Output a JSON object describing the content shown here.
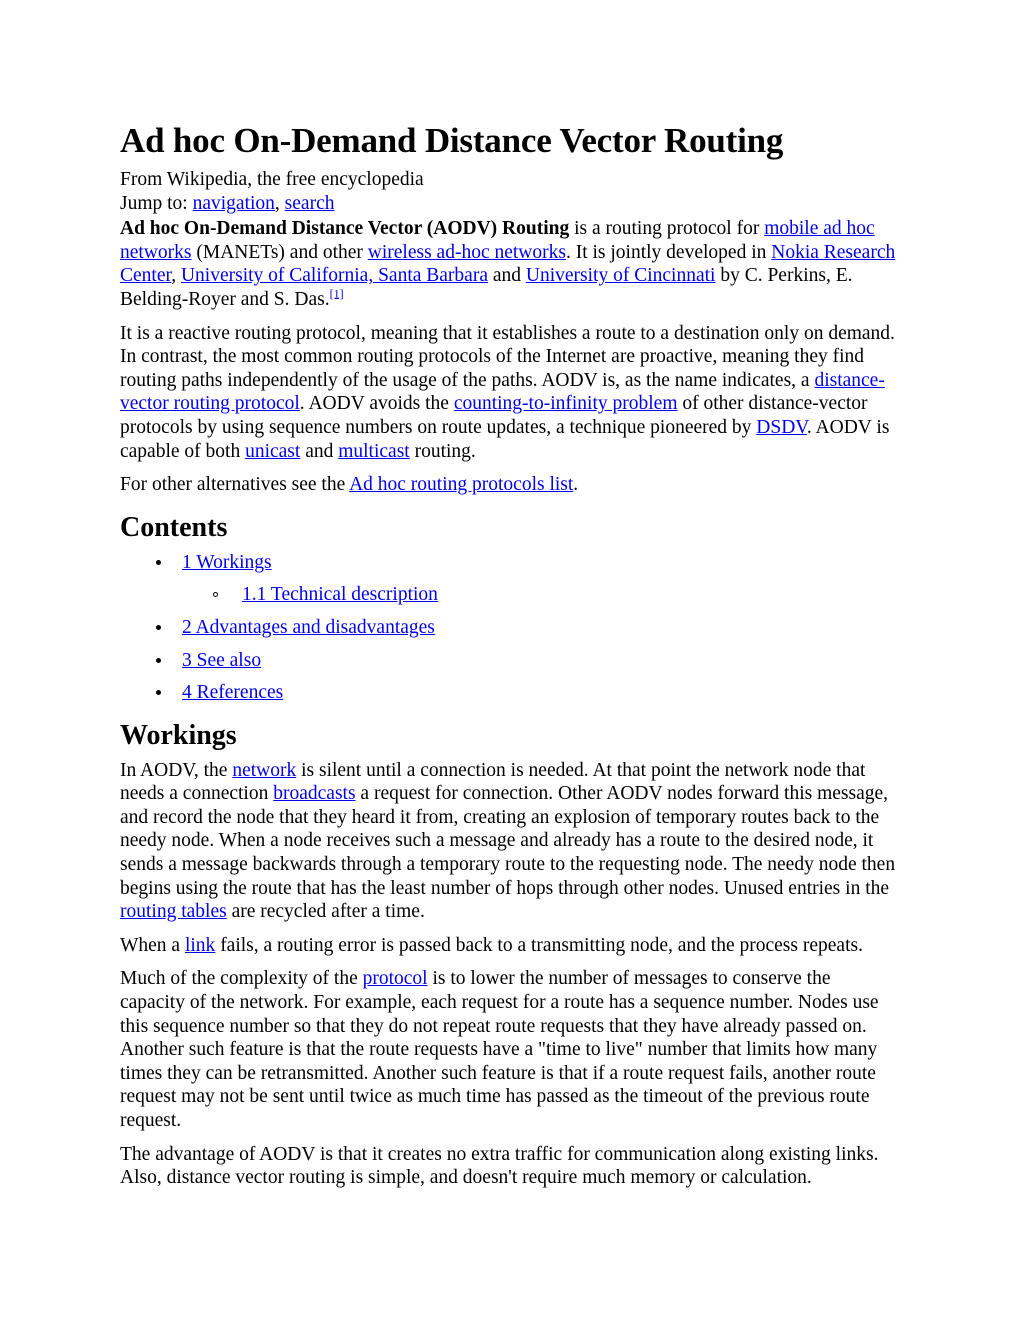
{
  "document": {
    "title": "Ad hoc On-Demand Distance Vector Routing",
    "source_line": "From Wikipedia, the free encyclopedia",
    "jump_prefix": "Jump to: ",
    "jump_nav_label": "navigation",
    "jump_separator": ", ",
    "jump_search_label": "search",
    "link_color": "#0000ee",
    "text_color": "#000000",
    "background_color": "#ffffff"
  },
  "lead": {
    "bold_term": "Ad hoc On-Demand Distance Vector (AODV) Routing",
    "t1": " is a routing protocol for ",
    "link_manet": "mobile ad hoc networks",
    "t2": " (MANETs) and other ",
    "link_wireless": "wireless ad-hoc networks",
    "t3": ". It is jointly developed in ",
    "link_nokia": "Nokia Research Center",
    "t4": ", ",
    "link_ucsb": "University of California, Santa Barbara",
    "t5": " and ",
    "link_cincinnati": "University of Cincinnati",
    "t6": " by C. Perkins, E. Belding-Royer and S. Das.",
    "ref_marker": "[1]"
  },
  "para_reactive": {
    "t1": "It is a reactive routing protocol, meaning that it establishes a route to a destination only on demand. In contrast, the most common routing protocols of the Internet are proactive, meaning they find routing paths independently of the usage of the paths. AODV is, as the name indicates, a ",
    "link_dv": "distance-vector routing protocol",
    "t2": ". AODV avoids the ",
    "link_cti": "counting-to-infinity problem",
    "t3": " of other distance-vector protocols by using sequence numbers on route updates, a technique pioneered by ",
    "link_dsdv": "DSDV",
    "t4": ". AODV is capable of both ",
    "link_unicast": "unicast",
    "t5": " and ",
    "link_multicast": "multicast",
    "t6": " routing."
  },
  "para_alternatives": {
    "t1": "For other alternatives see the ",
    "link_adhoc_list": "Ad hoc routing protocols list",
    "t2": "."
  },
  "contents": {
    "heading": "Contents",
    "items": [
      {
        "label": "1 Workings",
        "children": [
          {
            "label": "1.1 Technical description"
          }
        ]
      },
      {
        "label": "2 Advantages and disadvantages",
        "children": []
      },
      {
        "label": "3 See also",
        "children": []
      },
      {
        "label": "4 References",
        "children": []
      }
    ]
  },
  "workings": {
    "heading": "Workings",
    "p1": {
      "t1": "In AODV, the ",
      "link_network": "network",
      "t2": " is silent until a connection is needed. At that point the network node that needs a connection ",
      "link_broadcasts": "broadcasts",
      "t3": " a request for connection. Other AODV nodes forward this message, and record the node that they heard it from, creating an explosion of temporary routes back to the needy node. When a node receives such a message and already has a route to the desired node, it sends a message backwards through a temporary route to the requesting node. The needy node then begins using the route that has the least number of hops through other nodes. Unused entries in the ",
      "link_routing_tables": "routing tables",
      "t4": " are recycled after a time."
    },
    "p2": {
      "t1": "When a ",
      "link_link": "link",
      "t2": " fails, a routing error is passed back to a transmitting node, and the process repeats."
    },
    "p3": {
      "t1": "Much of the complexity of the ",
      "link_protocol": "protocol",
      "t2": " is to lower the number of messages to conserve the capacity of the network. For example, each request for a route has a sequence number. Nodes use this sequence number so that they do not repeat route requests that they have already passed on. Another such feature is that the route requests have a \"time to live\" number that limits how many times they can be retransmitted. Another such feature is that if a route request fails, another route request may not be sent until twice as much time has passed as the timeout of the previous route request."
    },
    "p4": {
      "t1": "The advantage of AODV is that it creates no extra traffic for communication along existing links. Also, distance vector routing is simple, and doesn't require much memory or calculation."
    }
  }
}
